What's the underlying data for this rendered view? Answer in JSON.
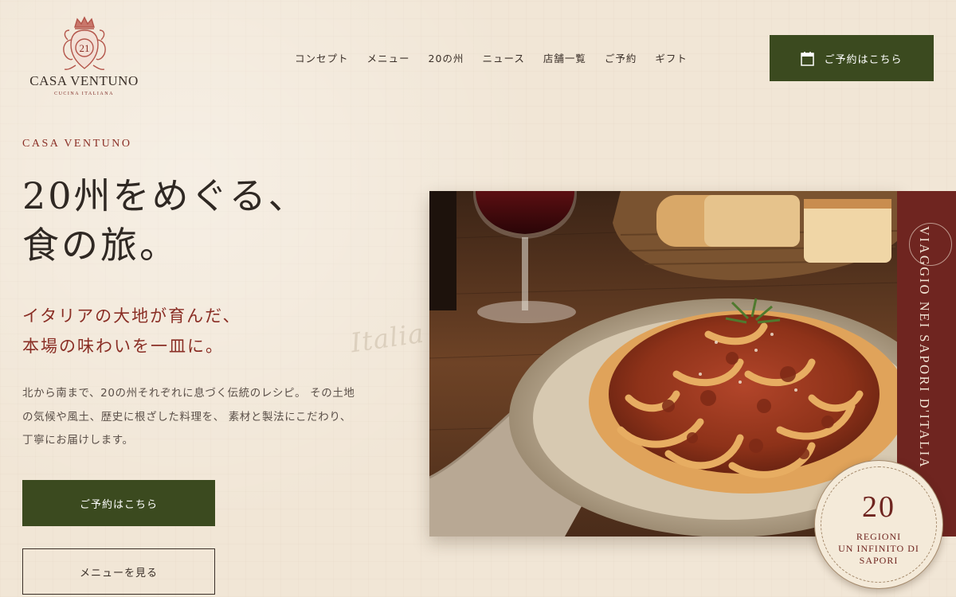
{
  "header": {
    "logo": {
      "numeral": "21",
      "brand": "CASA VENTUNO",
      "tagline": "CUCINA ITALIANA"
    },
    "nav": [
      "コンセプト",
      "メニュー",
      "20の州",
      "ニュース",
      "店舗一覧",
      "ご予約",
      "ギフト"
    ],
    "reserve_button": {
      "label": "ご予約はこちら",
      "icon": "calendar-icon"
    }
  },
  "hero": {
    "eyebrow": "CASA VENTUNO",
    "headline": [
      "20州をめぐる、",
      "食の旅。"
    ],
    "subhead": [
      "イタリアの大地が育んだ、",
      "本場の味わいを一皿に。"
    ],
    "watermark": "Italia",
    "body": [
      "北から南まで、20の州それぞれに息づく伝統のレシピ。 その土地",
      "の気候や風土、歴史に根ざした料理を、 素材と製法にこだわり、",
      "丁寧にお届けします。"
    ],
    "primary_button": "ご予約はこちら",
    "secondary_button": "メニューを見る",
    "side_text": "VIAGGIO NEI SAPORI D'ITALIA",
    "badge": {
      "number": "20",
      "lines": [
        "REGIONI",
        "UN INFINITO DI",
        "SAPORI"
      ]
    }
  },
  "colors": {
    "accent_green": "#3b4a1f",
    "accent_red": "#8a2e25",
    "band": "#6f2520",
    "background": "#f1e6d6"
  }
}
